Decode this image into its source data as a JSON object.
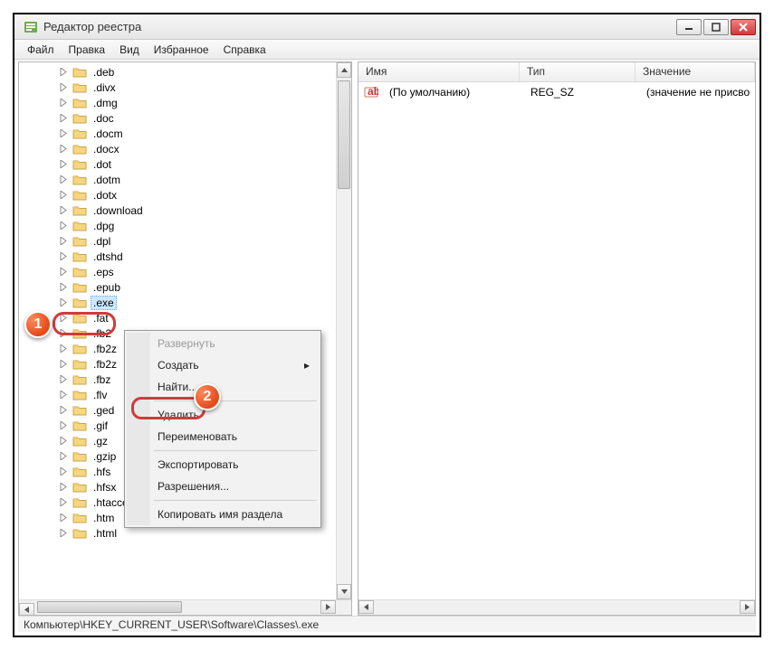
{
  "window": {
    "title": "Редактор реестра"
  },
  "menu": {
    "file": "Файл",
    "edit": "Правка",
    "view": "Вид",
    "favorites": "Избранное",
    "help": "Справка"
  },
  "tree": {
    "items": [
      ".deb",
      ".divx",
      ".dmg",
      ".doc",
      ".docm",
      ".docx",
      ".dot",
      ".dotm",
      ".dotx",
      ".download",
      ".dpg",
      ".dpl",
      ".dtshd",
      ".eps",
      ".epub",
      ".exe",
      ".fat",
      ".fb2",
      ".fb2z",
      ".fb2z",
      ".fbz",
      ".flv",
      ".ged",
      ".gif",
      ".gz",
      ".gzip",
      ".hfs",
      ".hfsx",
      ".htaccess",
      ".htm",
      ".html"
    ],
    "selected_index": 15
  },
  "list": {
    "headers": {
      "name": "Имя",
      "type": "Тип",
      "data": "Значение"
    },
    "col_widths": {
      "name": 178,
      "type": 128,
      "data": 130
    },
    "rows": [
      {
        "name": "(По умолчанию)",
        "type": "REG_SZ",
        "data": "(значение не присво"
      }
    ]
  },
  "context_menu": {
    "expand": "Развернуть",
    "new": "Создать",
    "find": "Найти...",
    "delete": "Удалить",
    "rename": "Переименовать",
    "export": "Экспортировать",
    "permissions": "Разрешения...",
    "copy_key_name": "Копировать имя раздела"
  },
  "callouts": {
    "one": "1",
    "two": "2"
  },
  "statusbar": {
    "path": "Компьютер\\HKEY_CURRENT_USER\\Software\\Classes\\.exe"
  }
}
